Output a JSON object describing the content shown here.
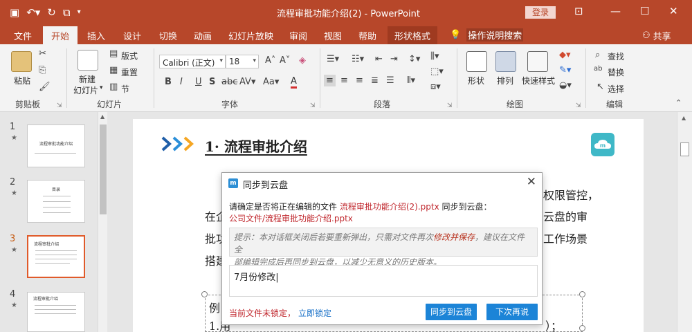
{
  "window": {
    "title": "流程审批功能介绍(2)  -  PowerPoint",
    "login_label": "登录"
  },
  "ribbon_tabs": [
    "文件",
    "开始",
    "插入",
    "设计",
    "切换",
    "动画",
    "幻灯片放映",
    "审阅",
    "视图",
    "帮助",
    "形状格式"
  ],
  "tell_me": "操作说明搜索",
  "share": "共享",
  "ribbon": {
    "groups": {
      "clipboard": "剪贴板",
      "slides": "幻灯片",
      "font": "字体",
      "paragraph": "段落",
      "drawing": "绘图",
      "editing": "编辑"
    },
    "paste": "粘贴",
    "new_slide_line1": "新建",
    "new_slide_line2": "幻灯片",
    "layout": "版式",
    "reset": "重置",
    "section": "节",
    "font_name": "Calibri (正文)",
    "font_size": "18",
    "shape": "形状",
    "arrange": "排列",
    "quick_styles": "快速样式",
    "find": "查找",
    "replace": "替换",
    "select": "选择"
  },
  "thumbnails": [
    {
      "num": "1",
      "title": "流程审批功能介绍"
    },
    {
      "num": "2",
      "title": "目录"
    },
    {
      "num": "3",
      "title": "流程审批介绍"
    },
    {
      "num": "4",
      "title": "流程审批介绍"
    }
  ],
  "slide": {
    "title": "1· 流程审批介绍",
    "line1_right": "权限管控，",
    "line2_left": "在企",
    "line2_right": "云盘的审",
    "line3_left": "批功",
    "line3_right": "工作场景",
    "line4_left": "搭建",
    "line5_left": "例",
    "line6_left": "1.用",
    "line6_right": "）；"
  },
  "dialog": {
    "title": "同步到云盘",
    "confirm_prefix": "请确定是否将正在编辑的文件",
    "file_name": "流程审批功能介绍(2).pptx",
    "confirm_suffix": "同步到云盘：",
    "target_path": "公司文件/流程审批功能介绍.pptx",
    "tip_part1": "提示：本对话框关闭后若要重新弹出，只需对文件再次",
    "tip_emphasis": "修改并保存",
    "tip_part2": "，建议在文件全",
    "tip_line2": "部编辑完成后再同步到云盘，以减少无意义的历史版本。",
    "note_value": "7月份修改",
    "lock_status": "当前文件未锁定，",
    "lock_link": "立即锁定",
    "sync_button": "同步到云盘",
    "later_button": "下次再说"
  },
  "colors": {
    "accent": "#b7472a",
    "dialog_button": "#1c84d7",
    "highlight_red": "#c0272d"
  }
}
